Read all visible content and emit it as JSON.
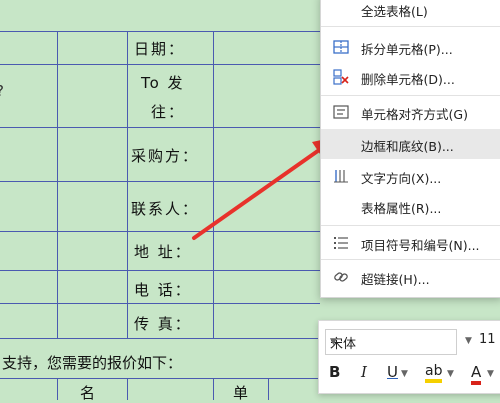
{
  "document": {
    "labels": {
      "date": "日期：",
      "to_line1": "To  发",
      "to_line2": "往：",
      "purchaser": "采购方：",
      "contact": "联系人：",
      "address": "地  址：",
      "phone": "电  话：",
      "fax": "传  真："
    },
    "body_line": "支持，您需要的报价如下：",
    "table_header_name": "名",
    "table_header_unit": "单"
  },
  "context_menu": {
    "items": [
      {
        "label": "全选表格(L)",
        "icon": "none"
      },
      {
        "label": "拆分单元格(P)...",
        "icon": "split-cell-icon"
      },
      {
        "label": "删除单元格(D)...",
        "icon": "delete-cell-icon"
      },
      {
        "label": "单元格对齐方式(G)",
        "icon": "cell-align-icon"
      },
      {
        "label": "边框和底纹(B)...",
        "icon": "none"
      },
      {
        "label": "文字方向(X)...",
        "icon": "text-direction-icon"
      },
      {
        "label": "表格属性(R)...",
        "icon": "none"
      },
      {
        "label": "项目符号和编号(N)...",
        "icon": "list-bullets-icon"
      },
      {
        "label": "超链接(H)...",
        "icon": "hyperlink-icon"
      }
    ],
    "hovered_index": 4
  },
  "mini_toolbar": {
    "font_name": "宋体",
    "font_size": "11",
    "bold": "B",
    "italic": "I",
    "underline": "U",
    "highlight": "ab",
    "font_color": "A"
  },
  "colors": {
    "page_bg": "#c7e6c7",
    "grid_line": "#4a5ab0",
    "arrow": "#e8322b",
    "highlight_bar": "#f5d000",
    "font_color_bar": "#d8231a",
    "underline_blue": "#2b5fb8"
  }
}
